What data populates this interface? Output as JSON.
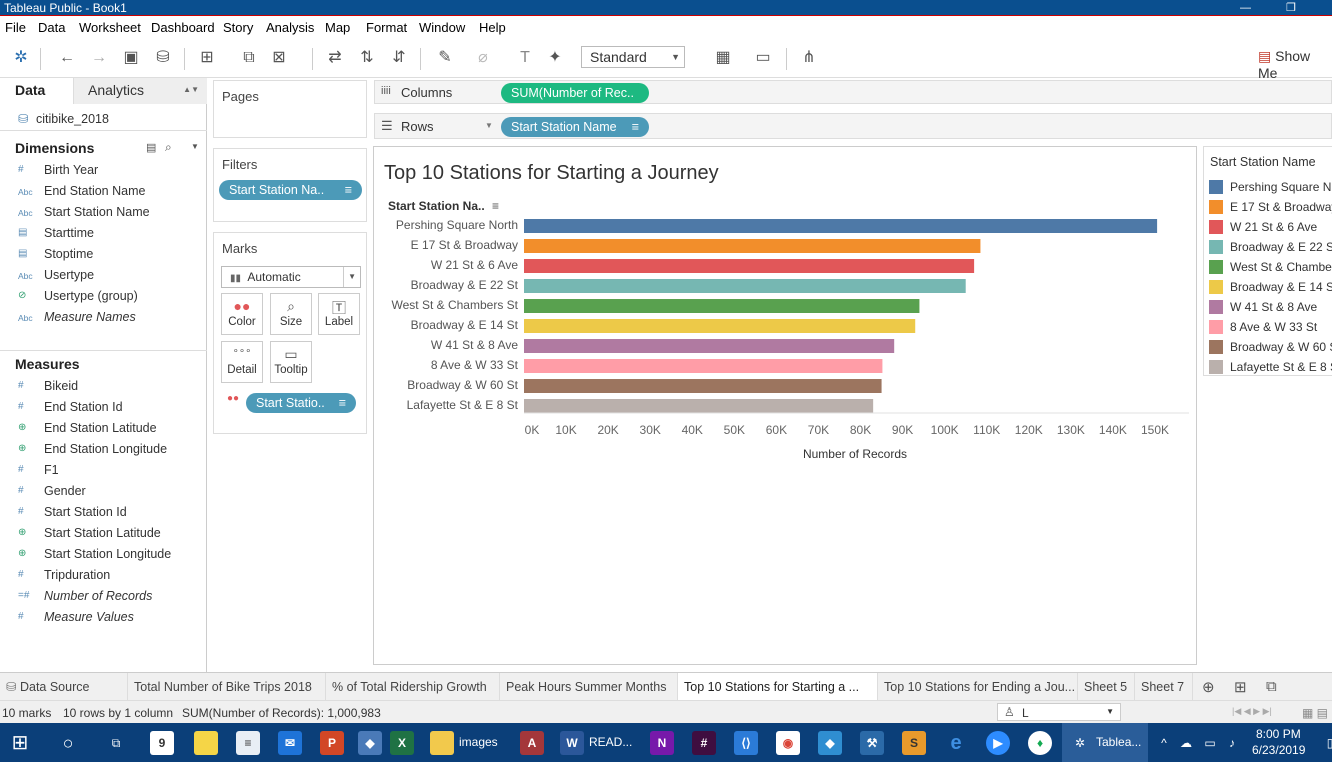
{
  "window": {
    "title": "Tableau Public - Book1"
  },
  "menu": [
    "File",
    "Data",
    "Worksheet",
    "Dashboard",
    "Story",
    "Analysis",
    "Map",
    "Format",
    "Window",
    "Help"
  ],
  "toolbar": {
    "fit": "Standard",
    "show_me": "Show Me"
  },
  "data_pane": {
    "tabs": {
      "data": "Data",
      "analytics": "Analytics"
    },
    "datasource": "citibike_2018",
    "dimensions_header": "Dimensions",
    "dimensions": [
      {
        "icon": "#",
        "name": "Birth Year"
      },
      {
        "icon": "Abc",
        "name": "End Station Name"
      },
      {
        "icon": "Abc",
        "name": "Start Station Name"
      },
      {
        "icon": "cal",
        "name": "Starttime"
      },
      {
        "icon": "cal",
        "name": "Stoptime"
      },
      {
        "icon": "Abc",
        "name": "Usertype"
      },
      {
        "icon": "clip",
        "name": "Usertype (group)"
      },
      {
        "icon": "Abc",
        "name": "Measure Names"
      }
    ],
    "measures_header": "Measures",
    "measures": [
      {
        "icon": "#",
        "name": "Bikeid"
      },
      {
        "icon": "#",
        "name": "End Station Id"
      },
      {
        "icon": "globe",
        "name": "End Station Latitude"
      },
      {
        "icon": "globe",
        "name": "End Station Longitude"
      },
      {
        "icon": "#",
        "name": "F1"
      },
      {
        "icon": "#",
        "name": "Gender"
      },
      {
        "icon": "#",
        "name": "Start Station Id"
      },
      {
        "icon": "globe",
        "name": "Start Station Latitude"
      },
      {
        "icon": "globe",
        "name": "Start Station Longitude"
      },
      {
        "icon": "#",
        "name": "Tripduration"
      },
      {
        "icon": "=#",
        "name": "Number of Records"
      },
      {
        "icon": "#",
        "name": "Measure Values"
      }
    ]
  },
  "cards": {
    "pages": "Pages",
    "filters": "Filters",
    "filter_pill": "Start Station Na..",
    "marks": "Marks",
    "mark_type": "Automatic",
    "mark_buttons": {
      "color": "Color",
      "size": "Size",
      "label": "Label",
      "detail": "Detail",
      "tooltip": "Tooltip"
    },
    "color_pill": "Start Statio.."
  },
  "shelves": {
    "columns_label": "Columns",
    "columns_pill": "SUM(Number of Rec..",
    "rows_label": "Rows",
    "rows_pill": "Start Station Name"
  },
  "chart_data": {
    "type": "bar",
    "orientation": "horizontal",
    "title": "Top 10 Stations for Starting a Journey",
    "ylabel": "Start Station Na..",
    "xlabel": "Number of Records",
    "xlim": [
      0,
      160000
    ],
    "x_ticks": [
      "0K",
      "10K",
      "20K",
      "30K",
      "40K",
      "50K",
      "60K",
      "70K",
      "80K",
      "90K",
      "100K",
      "110K",
      "120K",
      "130K",
      "140K",
      "150K"
    ],
    "categories": [
      "Pershing Square North",
      "E 17 St & Broadway",
      "W 21 St & 6 Ave",
      "Broadway & E 22 St",
      "West St & Chambers St",
      "Broadway & E 14 St",
      "W 41 St & 8 Ave",
      "8 Ave & W 33 St",
      "Broadway & W 60 St",
      "Lafayette St & E 8 St"
    ],
    "values": [
      150500,
      108500,
      107000,
      105000,
      94000,
      93000,
      88000,
      85200,
      85000,
      83000
    ],
    "colors": [
      "#4e79a7",
      "#f28e2b",
      "#e15759",
      "#76b7b2",
      "#59a14f",
      "#edc948",
      "#b07aa1",
      "#ff9da7",
      "#9c755f",
      "#bab0ac"
    ]
  },
  "legend": {
    "title": "Start Station Name",
    "items": [
      "Pershing Square N",
      "E 17 St & Broadway",
      "W 21 St & 6 Ave",
      "Broadway & E 22 St",
      "West St & Chambers",
      "Broadway & E 14 St",
      "W 41 St & 8 Ave",
      "8 Ave & W 33 St",
      "Broadway & W 60 S",
      "Lafayette St & E 8 S"
    ]
  },
  "sheet_tabs": {
    "data_source": "Data Source",
    "tabs": [
      "Total Number of Bike Trips 2018",
      "% of Total Ridership Growth",
      "Peak Hours Summer Months",
      "Top 10 Stations for Starting a ...",
      "Top 10 Stations for Ending a Jou...",
      "Sheet 5",
      "Sheet 7"
    ],
    "active_index": 3
  },
  "status": {
    "marks": "10 marks",
    "dims": "10 rows by 1 column",
    "sum": "SUM(Number of Records): 1,000,983",
    "user": "L"
  },
  "taskbar": {
    "calendar_day": "9",
    "explorer_label": "images",
    "word_label": "READ...",
    "tableau_label": "Tablea...",
    "time": "8:00 PM",
    "date": "6/23/2019"
  },
  "accent": {
    "pill_blue": "#4c9ab8",
    "pill_green": "#1db981",
    "titlebar": "#0a4f8f",
    "taskbar": "#0b3f79"
  }
}
